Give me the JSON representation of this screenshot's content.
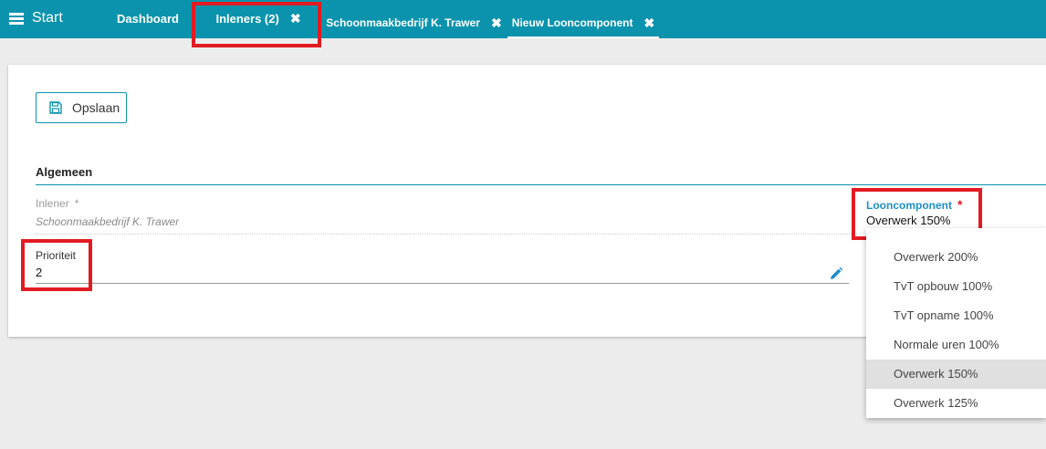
{
  "topbar": {
    "start_label": "Start",
    "tabs": [
      {
        "label": "Dashboard",
        "closable": false
      },
      {
        "label": "Inleners (2)",
        "closable": true
      },
      {
        "label": "Schoonmaakbedrijf K. Trawer",
        "closable": true
      },
      {
        "label": "Nieuw Looncomponent",
        "closable": true
      }
    ],
    "close_glyph": "✖",
    "active_tab": "Nieuw Looncomponent"
  },
  "toolbar": {
    "save_label": "Opslaan"
  },
  "section": {
    "title": "Algemeen"
  },
  "fields": {
    "inlener": {
      "label": "Inlener",
      "required_mark": "*",
      "value": "Schoonmaakbedrijf K. Trawer"
    },
    "prioriteit": {
      "label": "Prioriteit",
      "value": "2"
    },
    "looncomponent": {
      "label": "Looncomponent",
      "required_mark": "*",
      "value": "Overwerk 150%"
    }
  },
  "dropdown": {
    "options": [
      {
        "label": "Overwerk 200%"
      },
      {
        "label": "TvT opbouw 100%"
      },
      {
        "label": "TvT opname 100%"
      },
      {
        "label": "Normale uren 100%"
      },
      {
        "label": "Overwerk 150%"
      },
      {
        "label": "Overwerk 125%"
      }
    ],
    "selected": "Overwerk 150%"
  },
  "icons": {
    "menu": "hamburger-icon",
    "close": "close-icon",
    "save": "floppy-disk-icon",
    "edit": "pencil-icon"
  },
  "colors": {
    "topbar": "#0b93ad",
    "accent": "#0b93ad",
    "label_active": "#1f8fc8",
    "required": "#e21b23",
    "highlight_box": "#e21b23",
    "selected_option_bg": "#e0e0e0"
  }
}
